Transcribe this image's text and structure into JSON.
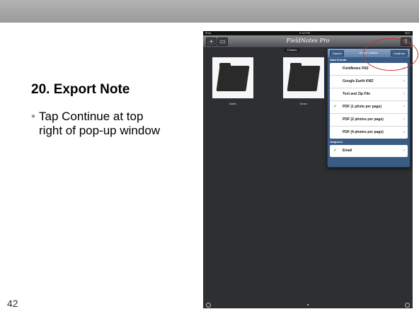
{
  "slide": {
    "title": "20. Export Note",
    "bullet": "Tap Continue at top right of pop-up window",
    "page_number": "42"
  },
  "ipad": {
    "status": {
      "carrier": "iPad",
      "time": "9:18 PM",
      "battery": "56%"
    },
    "app_title": "FieldNotes Pro",
    "segment_label": "Folders",
    "folders": [
      {
        "label": "Notes"
      },
      {
        "label": "Demo"
      }
    ],
    "popover": {
      "cancel_label": "Cancel",
      "title": "Export Options",
      "continue_label": "Continue",
      "data_format_header": "Data Format",
      "formats": [
        {
          "label": "FieldNotes FNZ",
          "checked": false
        },
        {
          "label": "Google Earth KMZ",
          "checked": false
        },
        {
          "label": "Text and Zip File",
          "checked": false
        },
        {
          "label": "PDF (1 photo per page)",
          "checked": true
        },
        {
          "label": "PDF (2 photos per page)",
          "checked": false
        },
        {
          "label": "PDF (4 photos per page)",
          "checked": false
        }
      ],
      "output_header": "Output to",
      "outputs": [
        {
          "label": "Email",
          "checked": true
        }
      ]
    }
  },
  "colors": {
    "highlight_circle": "#c8332e",
    "check": "#3aa135",
    "popover_bg": "#3a5b84"
  }
}
